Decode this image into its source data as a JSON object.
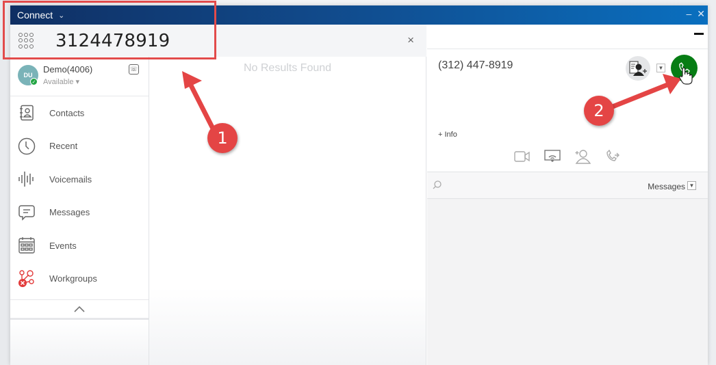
{
  "titlebar": {
    "app_title": "Connect",
    "title_chevron": "⌄",
    "minimize": "–",
    "close": "✕"
  },
  "dialer": {
    "value": "3124478919",
    "clear": "×",
    "icon": "dialpad-icon"
  },
  "user": {
    "initials": "DU",
    "name": "Demo(4006)",
    "status": "Available ▾",
    "presence_color": "#23a544"
  },
  "sidebar": {
    "items": [
      {
        "label": "Contacts",
        "icon": "contacts-book-icon"
      },
      {
        "label": "Recent",
        "icon": "clock-icon"
      },
      {
        "label": "Voicemails",
        "icon": "voicemail-waveform-icon"
      },
      {
        "label": "Messages",
        "icon": "message-bubble-icon"
      },
      {
        "label": "Events",
        "icon": "calendar-icon"
      },
      {
        "label": "Workgroups",
        "icon": "workgroups-icon"
      }
    ],
    "collapse": "^"
  },
  "results": {
    "empty_text": "No Results Found"
  },
  "contact_panel": {
    "number": "(312) 447-8919",
    "info_link": "+ Info",
    "call_color": "#077d14",
    "actions": [
      "video-icon",
      "screen-share-icon",
      "add-participant-icon",
      "transfer-icon"
    ]
  },
  "messages_bar": {
    "filter_label": "Messages",
    "dropdown": "⌄"
  },
  "annotations": {
    "step1": "1",
    "step2": "2",
    "color": "#e44545"
  }
}
